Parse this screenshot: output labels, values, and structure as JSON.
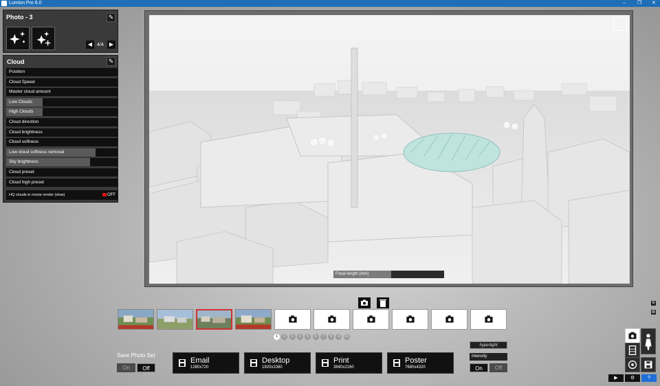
{
  "window": {
    "title": "Lumion Pro 6.0",
    "controls": [
      "–",
      "❐",
      "✕"
    ]
  },
  "photo_panel": {
    "title": "Photo - 3",
    "page": "4/4"
  },
  "cloud_panel": {
    "title": "Cloud",
    "sliders": [
      {
        "label": "Position",
        "value": 0.0
      },
      {
        "label": "Cloud Speed",
        "value": 0.0
      },
      {
        "label": "Master cloud amount",
        "value": 0.0
      },
      {
        "label": "Low Clouds",
        "value": 0.33
      },
      {
        "label": "High Clouds",
        "value": 0.33
      },
      {
        "label": "Cloud direction",
        "value": 0.0
      },
      {
        "label": "Cloud brightness",
        "value": 0.0
      },
      {
        "label": "Cloud softness",
        "value": 0.0
      },
      {
        "label": "Low cloud softness removal",
        "value": 0.8
      },
      {
        "label": "Sky brightness",
        "value": 0.75
      },
      {
        "label": "Cloud preset",
        "value": 0.0
      },
      {
        "label": "Cloud high preset",
        "value": 0.0
      }
    ],
    "hq_clouds_label": "HQ clouds in movie render (slow)",
    "hq_clouds_state": "OFF"
  },
  "viewport": {
    "focal_length_label": "Focal length (mm)",
    "focal_length_level": 0.52
  },
  "photo_set": {
    "pages": [
      "1",
      "2",
      "3",
      "4",
      "5",
      "6",
      "7",
      "8",
      "9",
      "10"
    ],
    "active_page": "1"
  },
  "save_photo_set": {
    "label": "Save Photo Set",
    "on": "On",
    "off": "Off"
  },
  "export": [
    {
      "name": "Email",
      "size": "1280x720"
    },
    {
      "name": "Desktop",
      "size": "1920x1080"
    },
    {
      "name": "Print",
      "size": "3840x2160"
    },
    {
      "name": "Poster",
      "size": "7680x4320"
    }
  ],
  "hyperlight": {
    "logo": "hyperlight",
    "intensity_label": "Intensity",
    "on": "On",
    "off": "Off"
  },
  "colors": {
    "titlebar": "#1e6fb8",
    "selected_slot": "#cc3333",
    "help": "#1e6fd8"
  },
  "bottom_buttons": {
    "play": "▶",
    "settings": "⚙",
    "help": "?"
  }
}
